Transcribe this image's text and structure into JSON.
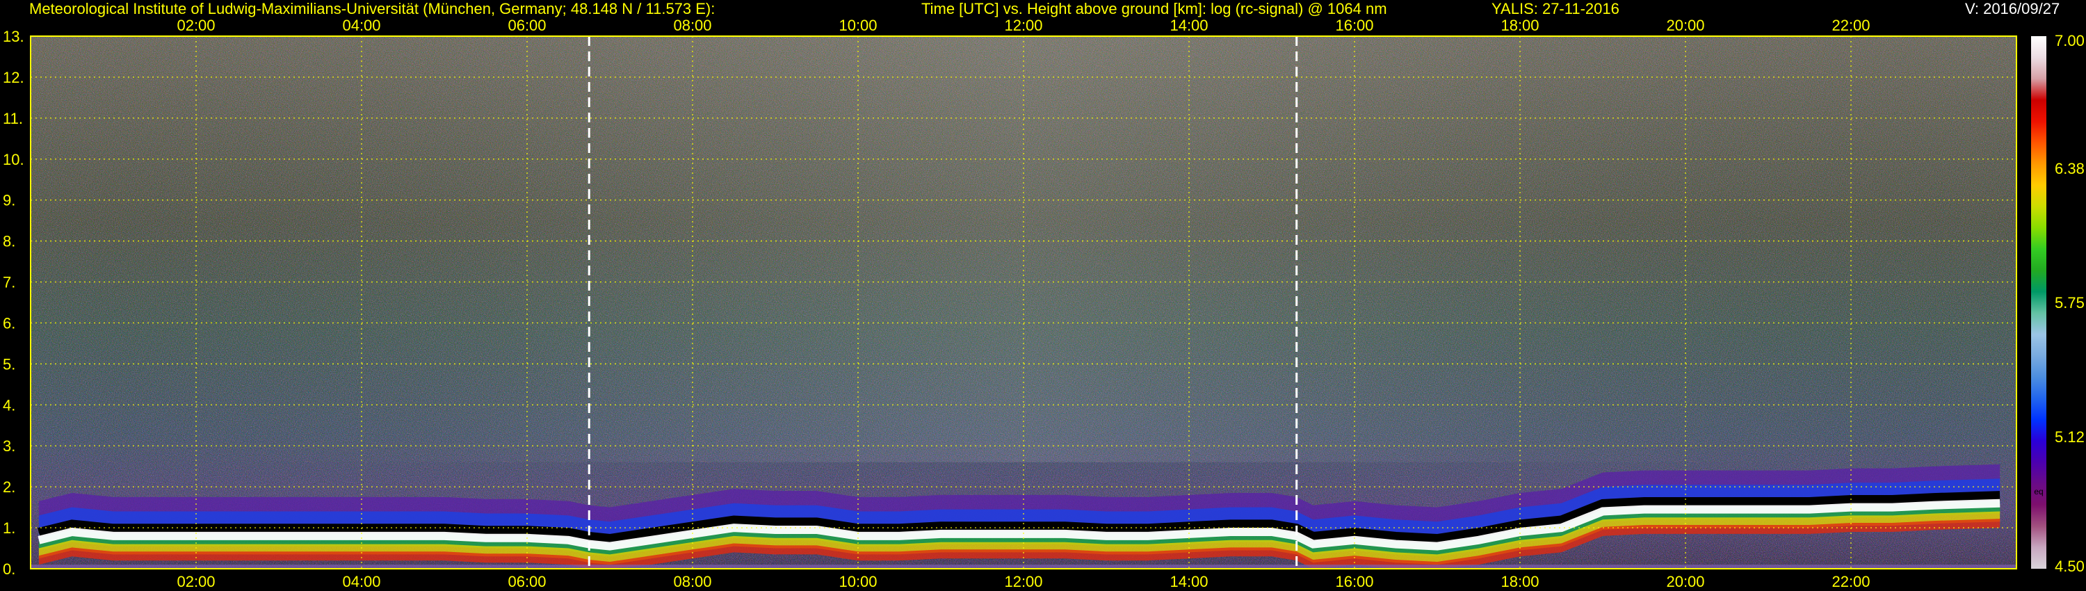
{
  "header": {
    "institute": "Meteorological Institute of Ludwig-Maximilians-Universität (München, Germany; 48.148 N / 11.573 E):",
    "plot_title": "Time [UTC] vs. Height above ground [km]: log (rc-signal) @ 1064 nm",
    "instrument_date": "YALIS: 27-11-2016",
    "version": "V: 2016/09/27"
  },
  "colors": {
    "background": "#000000",
    "text": "#ffff00",
    "grid": "#ffff00",
    "marker": "#ffffff"
  },
  "chart_data": {
    "type": "heatmap",
    "title": "Time [UTC] vs. Height above ground [km]: log (rc-signal) @ 1064 nm",
    "xlabel": "Time [UTC]",
    "ylabel": "Height above ground [km]",
    "xlim": [
      0,
      24
    ],
    "ylim": [
      0,
      13
    ],
    "x_ticks": [
      2,
      4,
      6,
      8,
      10,
      12,
      14,
      16,
      18,
      20,
      22
    ],
    "x_tick_labels": [
      "02:00",
      "04:00",
      "06:00",
      "08:00",
      "10:00",
      "12:00",
      "14:00",
      "16:00",
      "18:00",
      "20:00",
      "22:00"
    ],
    "y_ticks": [
      0,
      1,
      2,
      3,
      4,
      5,
      6,
      7,
      8,
      9,
      10,
      11,
      12,
      13
    ],
    "y_tick_labels": [
      "0.",
      "1.",
      "2.",
      "3.",
      "4.",
      "5.",
      "6.",
      "7.",
      "8.",
      "9.",
      "10.",
      "11.",
      "12.",
      "13."
    ],
    "grid": true,
    "vertical_markers": [
      6.75,
      15.3
    ],
    "colorbar": {
      "min": 4.5,
      "max": 7.0,
      "tick_values": [
        7.0,
        6.38,
        5.75,
        5.12,
        4.5
      ],
      "tick_labels": [
        "7.00",
        "6.38",
        "5.75",
        "5.12",
        "4.50"
      ],
      "unit_label": "eq",
      "colors_bottom_to_top": [
        "#d9d4da",
        "#c8a7c0",
        "#a2507f",
        "#7d0f6d",
        "#690b88",
        "#4b00b0",
        "#2a00d8",
        "#0033ff",
        "#2266ee",
        "#4c8ee0",
        "#79abe0",
        "#9cc5e6",
        "#63c2a4",
        "#009966",
        "#22aa22",
        "#33cc22",
        "#88dd00",
        "#ccdd00",
        "#ffcc00",
        "#ff9900",
        "#ff5500",
        "#ee1100",
        "#cc0000",
        "#d7a0a7",
        "#ecdde3",
        "#ffffff"
      ]
    },
    "boundary_layer_top_km": {
      "x": [
        0.1,
        0.5,
        1.0,
        1.5,
        2.0,
        2.5,
        3.0,
        3.5,
        4.0,
        4.5,
        5.0,
        5.5,
        6.0,
        6.5,
        6.75,
        7.0,
        7.5,
        8.0,
        8.5,
        9.0,
        9.5,
        10.0,
        10.5,
        11.0,
        11.5,
        12.0,
        12.5,
        13.0,
        13.5,
        14.0,
        14.5,
        15.0,
        15.3,
        15.5,
        16.0,
        16.5,
        17.0,
        17.5,
        18.0,
        18.5,
        19.0,
        19.5,
        20.0,
        20.5,
        21.0,
        21.5,
        22.0,
        22.5,
        23.0,
        23.8
      ],
      "y": [
        0.7,
        0.9,
        0.8,
        0.8,
        0.8,
        0.8,
        0.8,
        0.8,
        0.8,
        0.8,
        0.8,
        0.75,
        0.75,
        0.7,
        0.6,
        0.55,
        0.7,
        0.85,
        1.0,
        0.95,
        0.95,
        0.8,
        0.8,
        0.85,
        0.85,
        0.85,
        0.85,
        0.8,
        0.8,
        0.85,
        0.9,
        0.9,
        0.8,
        0.6,
        0.7,
        0.6,
        0.55,
        0.7,
        0.9,
        1.0,
        1.4,
        1.45,
        1.45,
        1.45,
        1.45,
        1.45,
        1.5,
        1.5,
        1.55,
        1.6
      ]
    }
  }
}
